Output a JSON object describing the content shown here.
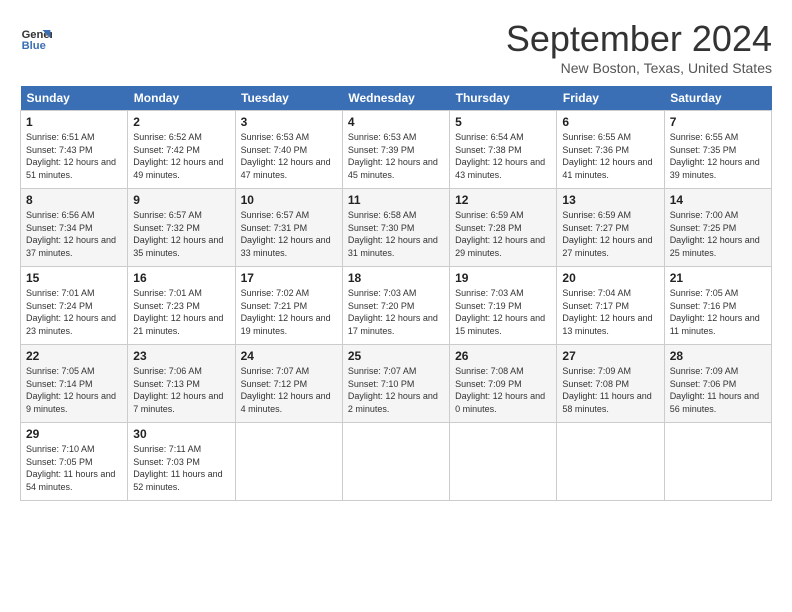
{
  "header": {
    "logo_line1": "General",
    "logo_line2": "Blue",
    "title": "September 2024",
    "location": "New Boston, Texas, United States"
  },
  "calendar": {
    "days_of_week": [
      "Sunday",
      "Monday",
      "Tuesday",
      "Wednesday",
      "Thursday",
      "Friday",
      "Saturday"
    ],
    "weeks": [
      [
        null,
        {
          "day": 2,
          "sunrise": "6:52 AM",
          "sunset": "7:42 PM",
          "daylight": "12 hours and 49 minutes."
        },
        {
          "day": 3,
          "sunrise": "6:53 AM",
          "sunset": "7:40 PM",
          "daylight": "12 hours and 47 minutes."
        },
        {
          "day": 4,
          "sunrise": "6:53 AM",
          "sunset": "7:39 PM",
          "daylight": "12 hours and 45 minutes."
        },
        {
          "day": 5,
          "sunrise": "6:54 AM",
          "sunset": "7:38 PM",
          "daylight": "12 hours and 43 minutes."
        },
        {
          "day": 6,
          "sunrise": "6:55 AM",
          "sunset": "7:36 PM",
          "daylight": "12 hours and 41 minutes."
        },
        {
          "day": 7,
          "sunrise": "6:55 AM",
          "sunset": "7:35 PM",
          "daylight": "12 hours and 39 minutes."
        }
      ],
      [
        {
          "day": 1,
          "sunrise": "6:51 AM",
          "sunset": "7:43 PM",
          "daylight": "12 hours and 51 minutes."
        },
        {
          "day": 8,
          "sunrise": "6:56 AM",
          "sunset": "7:34 PM",
          "daylight": "12 hours and 37 minutes."
        },
        {
          "day": 9,
          "sunrise": "6:57 AM",
          "sunset": "7:32 PM",
          "daylight": "12 hours and 35 minutes."
        },
        {
          "day": 10,
          "sunrise": "6:57 AM",
          "sunset": "7:31 PM",
          "daylight": "12 hours and 33 minutes."
        },
        {
          "day": 11,
          "sunrise": "6:58 AM",
          "sunset": "7:30 PM",
          "daylight": "12 hours and 31 minutes."
        },
        {
          "day": 12,
          "sunrise": "6:59 AM",
          "sunset": "7:28 PM",
          "daylight": "12 hours and 29 minutes."
        },
        {
          "day": 13,
          "sunrise": "6:59 AM",
          "sunset": "7:27 PM",
          "daylight": "12 hours and 27 minutes."
        },
        {
          "day": 14,
          "sunrise": "7:00 AM",
          "sunset": "7:25 PM",
          "daylight": "12 hours and 25 minutes."
        }
      ],
      [
        {
          "day": 15,
          "sunrise": "7:01 AM",
          "sunset": "7:24 PM",
          "daylight": "12 hours and 23 minutes."
        },
        {
          "day": 16,
          "sunrise": "7:01 AM",
          "sunset": "7:23 PM",
          "daylight": "12 hours and 21 minutes."
        },
        {
          "day": 17,
          "sunrise": "7:02 AM",
          "sunset": "7:21 PM",
          "daylight": "12 hours and 19 minutes."
        },
        {
          "day": 18,
          "sunrise": "7:03 AM",
          "sunset": "7:20 PM",
          "daylight": "12 hours and 17 minutes."
        },
        {
          "day": 19,
          "sunrise": "7:03 AM",
          "sunset": "7:19 PM",
          "daylight": "12 hours and 15 minutes."
        },
        {
          "day": 20,
          "sunrise": "7:04 AM",
          "sunset": "7:17 PM",
          "daylight": "12 hours and 13 minutes."
        },
        {
          "day": 21,
          "sunrise": "7:05 AM",
          "sunset": "7:16 PM",
          "daylight": "12 hours and 11 minutes."
        }
      ],
      [
        {
          "day": 22,
          "sunrise": "7:05 AM",
          "sunset": "7:14 PM",
          "daylight": "12 hours and 9 minutes."
        },
        {
          "day": 23,
          "sunrise": "7:06 AM",
          "sunset": "7:13 PM",
          "daylight": "12 hours and 7 minutes."
        },
        {
          "day": 24,
          "sunrise": "7:07 AM",
          "sunset": "7:12 PM",
          "daylight": "12 hours and 4 minutes."
        },
        {
          "day": 25,
          "sunrise": "7:07 AM",
          "sunset": "7:10 PM",
          "daylight": "12 hours and 2 minutes."
        },
        {
          "day": 26,
          "sunrise": "7:08 AM",
          "sunset": "7:09 PM",
          "daylight": "12 hours and 0 minutes."
        },
        {
          "day": 27,
          "sunrise": "7:09 AM",
          "sunset": "7:08 PM",
          "daylight": "11 hours and 58 minutes."
        },
        {
          "day": 28,
          "sunrise": "7:09 AM",
          "sunset": "7:06 PM",
          "daylight": "11 hours and 56 minutes."
        }
      ],
      [
        {
          "day": 29,
          "sunrise": "7:10 AM",
          "sunset": "7:05 PM",
          "daylight": "11 hours and 54 minutes."
        },
        {
          "day": 30,
          "sunrise": "7:11 AM",
          "sunset": "7:03 PM",
          "daylight": "11 hours and 52 minutes."
        },
        null,
        null,
        null,
        null,
        null
      ]
    ]
  }
}
